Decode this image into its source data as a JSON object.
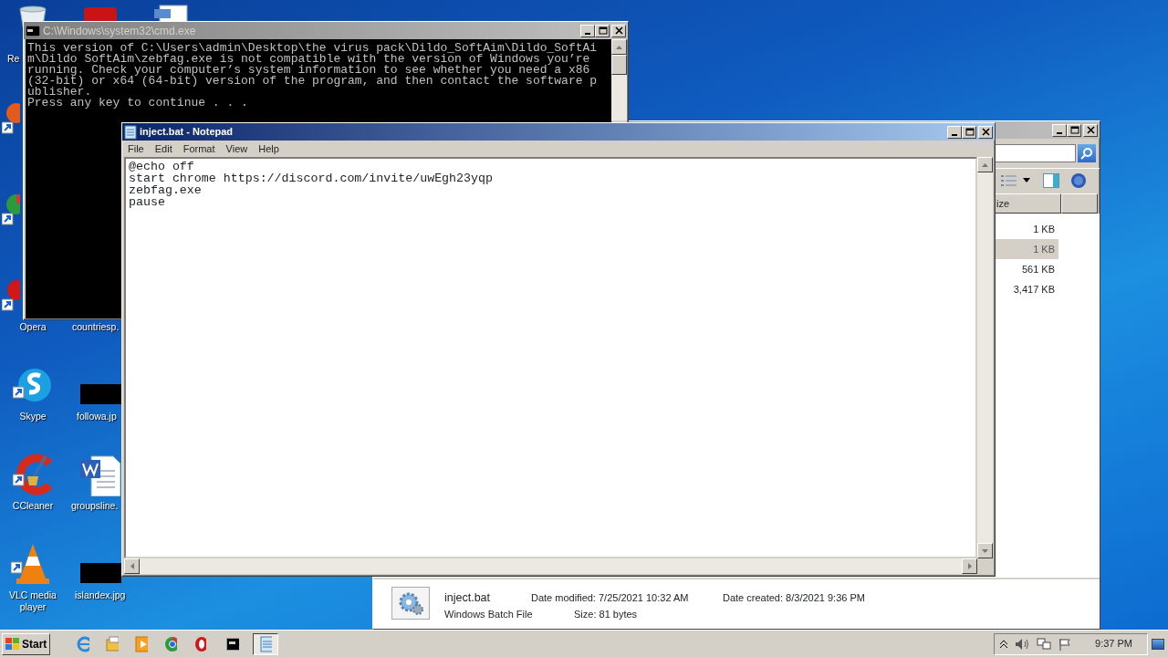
{
  "desktop_icons": [
    {
      "kind": "recycle",
      "label": "Re"
    },
    {
      "kind": "firefox"
    },
    {
      "kind": "chrome"
    },
    {
      "kind": "opera",
      "label": "Opera"
    },
    {
      "kind": "skype",
      "label": "Skype"
    },
    {
      "kind": "ccleaner",
      "label": "CCleaner"
    },
    {
      "kind": "vlc",
      "label": "VLC media player"
    },
    {
      "kind": "redapp"
    },
    {
      "kind": "document"
    },
    {
      "kind": "covered",
      "label": "countriesp."
    },
    {
      "kind": "blackthumb",
      "label": "followa.jp"
    },
    {
      "kind": "word",
      "label": "groupsline."
    },
    {
      "kind": "blackthumb",
      "label": "islandex.jpg"
    }
  ],
  "cmd_window": {
    "title": "C:\\Windows\\system32\\cmd.exe",
    "active": false,
    "lines": [
      "This version of C:\\Users\\admin\\Desktop\\the virus pack\\Dildo_SoftAim\\Dildo_SoftAi",
      "m\\Dildo SoftAim\\zebfag.exe is not compatible with the version of Windows you’re",
      "running. Check your computer’s system information to see whether you need a x86",
      "(32-bit) or x64 (64-bit) version of the program, and then contact the software p",
      "ublisher.",
      "Press any key to continue . . ."
    ]
  },
  "explorer_window": {
    "active": false,
    "column_header": "ize",
    "rows": [
      {
        "size": "1 KB",
        "selected": false
      },
      {
        "size": "1 KB",
        "selected": true
      },
      {
        "size": "561 KB",
        "selected": false
      },
      {
        "size": "3,417 KB",
        "selected": false
      }
    ],
    "details": {
      "name": "inject.bat",
      "type": "Windows Batch File",
      "modified": "Date modified: 7/25/2021 10:32 AM",
      "size": "Size: 81 bytes",
      "created": "Date created: 8/3/2021 9:36 PM"
    }
  },
  "notepad_window": {
    "title": "inject.bat - Notepad",
    "active": true,
    "menu": [
      "File",
      "Edit",
      "Format",
      "View",
      "Help"
    ],
    "lines": [
      "@echo off",
      "start chrome https://discord.com/invite/uwEgh23yqp",
      "zebfag.exe",
      "pause"
    ]
  },
  "taskbar": {
    "start": "Start",
    "items": [
      {
        "kind": "ie",
        "active": false
      },
      {
        "kind": "folder",
        "active": false
      },
      {
        "kind": "media",
        "active": false
      },
      {
        "kind": "chrome",
        "active": false
      },
      {
        "kind": "opera",
        "active": false
      },
      {
        "kind": "cmd",
        "active": false
      },
      {
        "kind": "notepad",
        "active": true
      }
    ],
    "clock": "9:37 PM"
  }
}
